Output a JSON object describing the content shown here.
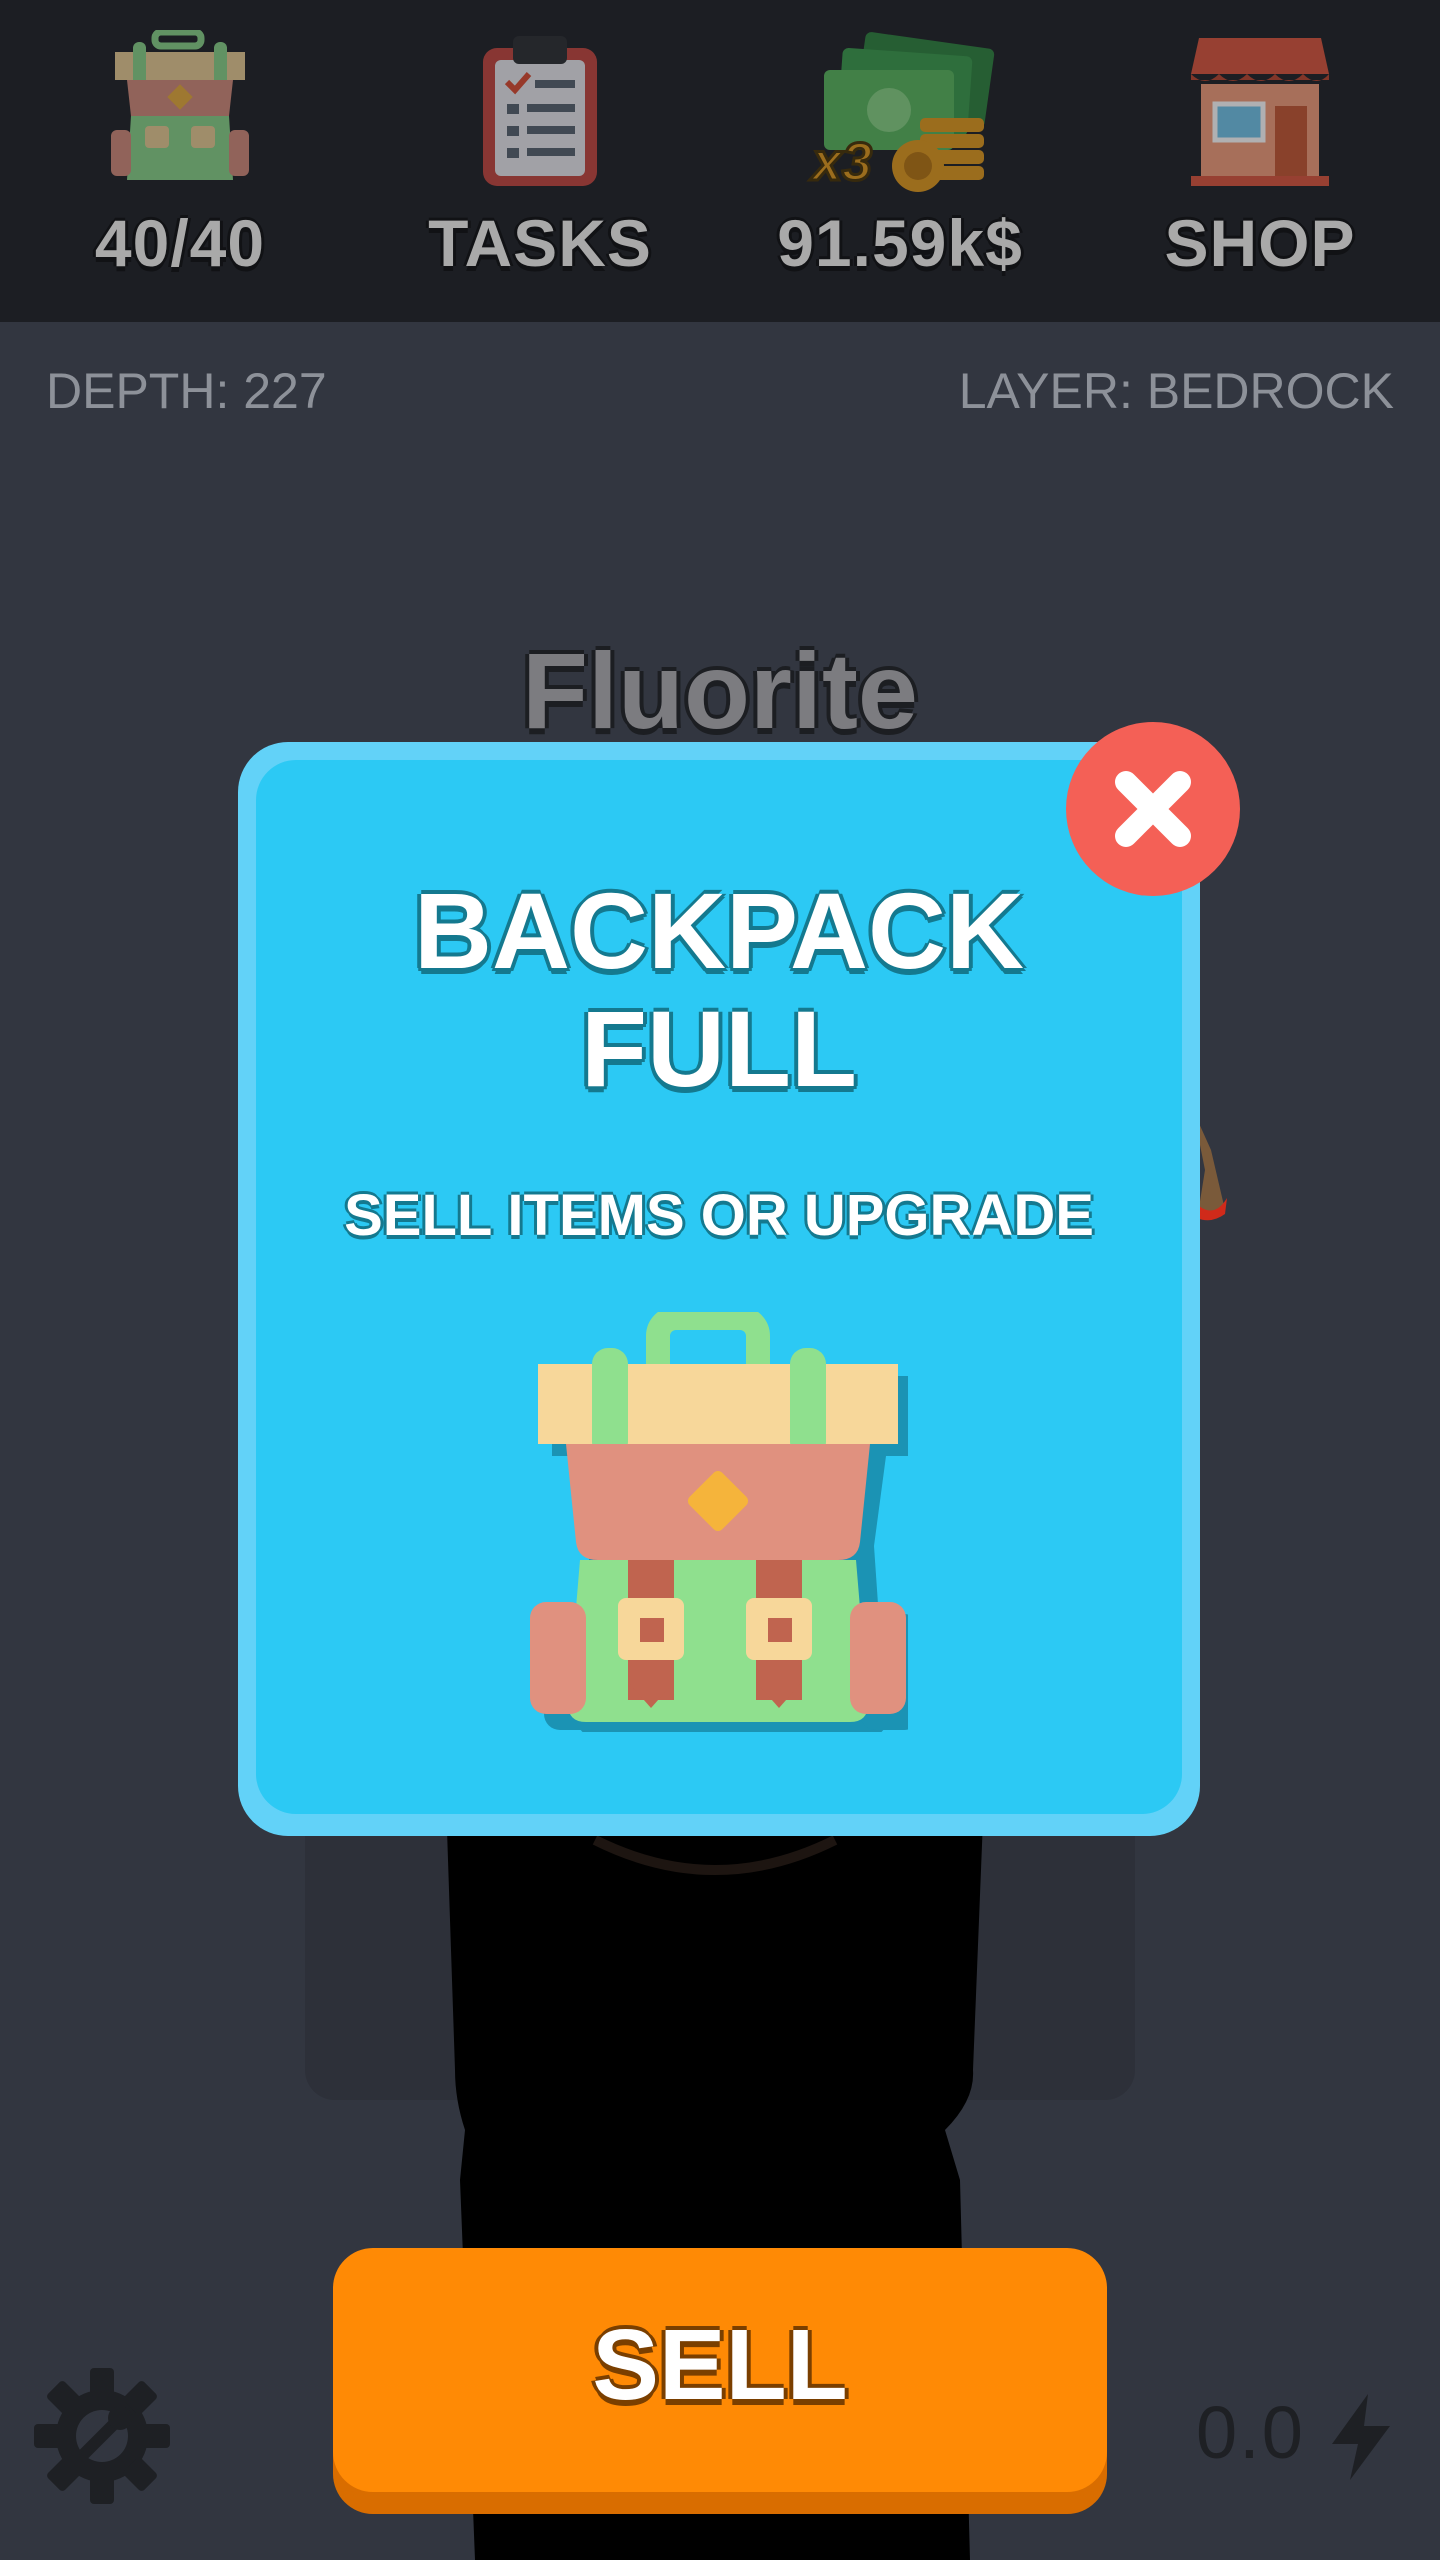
{
  "topbar": {
    "backpack": {
      "label": "40/40",
      "icon": "backpack-icon"
    },
    "tasks": {
      "label": "TASKS",
      "icon": "clipboard-icon"
    },
    "money": {
      "label": "91.59k$",
      "multiplier": "x3",
      "icon": "money-icon"
    },
    "shop": {
      "label": "SHOP",
      "icon": "shop-icon"
    }
  },
  "status": {
    "depth": "DEPTH: 227",
    "layer": "LAYER: BEDROCK"
  },
  "scene": {
    "ore_name": "Fluorite"
  },
  "modal": {
    "title_line1": "BACKPACK",
    "title_line2": "FULL",
    "subtitle": "SELL ITEMS OR UPGRADE",
    "icon": "backpack-icon",
    "close_icon": "close-icon"
  },
  "bottom": {
    "sell_label": "SELL",
    "energy_value": "0.0",
    "energy_icon": "lightning-icon",
    "settings_icon": "gear-wrench-icon"
  },
  "colors": {
    "background": "#323640",
    "topbar": "#1c1e23",
    "modal": "#2cc9f4",
    "close_button": "#f46056",
    "sell_button": "#ff8a05"
  }
}
